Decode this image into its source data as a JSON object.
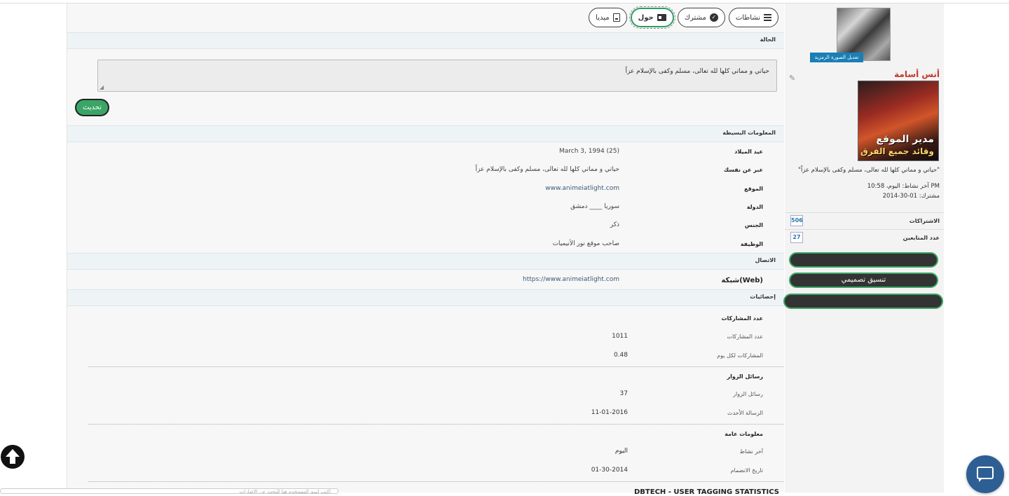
{
  "tabs": [
    {
      "label": "نشاطات",
      "icon": "list-icon"
    },
    {
      "label": "مشترك",
      "icon": "check-circle-icon"
    },
    {
      "label": "حول",
      "icon": "id-card-icon",
      "active": true
    },
    {
      "label": "ميديا",
      "icon": "media-file-icon"
    }
  ],
  "status": {
    "header": "الحالة",
    "text": "حياتي و مماتي كلها لله تعالى، مسلم وكفى بالإسلام عزاً",
    "update_label": "تحديث"
  },
  "basic": {
    "header": "المعلومات البسيطة",
    "rows": [
      {
        "label": "عيد الميلاد",
        "value": "March 3, 1994 (25)"
      },
      {
        "label": "عبر عن نفسك",
        "value": "حياتي و مماتي كلها لله تعالى، مسلم وكفى بالإسلام عزاً"
      },
      {
        "label": "الموقع",
        "value": "www.animeiatlight.com"
      },
      {
        "label": "الدولة",
        "value": "سوريا ____ دمشق"
      },
      {
        "label": "الجنس",
        "value": "ذكر"
      },
      {
        "label": "الوظيفة",
        "value": "صاحب موقع نور الأنيميات"
      }
    ]
  },
  "contact": {
    "header": "الاتصال",
    "label": "شبكة(Web)",
    "value": "https://www.animeiatlight.com"
  },
  "stats": {
    "header": "إحصائيات",
    "groups": [
      {
        "title": "عدد المشاركات",
        "rows": [
          {
            "label": "عدد المشاركات",
            "value": "1011"
          },
          {
            "label": "المشاركات لكل يوم",
            "value": "0.48"
          }
        ]
      },
      {
        "title": "رسائل الزوار",
        "rows": [
          {
            "label": "رسائل الزوار",
            "value": "37"
          },
          {
            "label": "الرسالة الأحدث",
            "value": "11-01-2016"
          }
        ]
      },
      {
        "title": "معلومات عامة",
        "rows": [
          {
            "label": "آخر نشاط",
            "value": "اليوم"
          },
          {
            "label": "تاريخ الانضمام",
            "value": "01-30-2014"
          }
        ]
      }
    ]
  },
  "bottom": {
    "title": "DBTECH - USER TAGGING STATISTICS",
    "input_text": "اكتب اسم المستخدم هنا للبحث عن الإشارات"
  },
  "sidebar": {
    "change_avatar": "تعديل الصورة الرمزية",
    "username": "أنس أسامة",
    "rank_line1": "مدير الموقع",
    "rank_line2": "وقائد جميع الفرق",
    "quote": "\"حياتي و مماتي كلها لله تعالى، مسلم وكفى بالإسلام عزاً\"",
    "last_activity": "آخر نشاط: اليوم، 10:58 PM",
    "joined": "مشترك: 01-30-2014",
    "subscriptions_label": "الاشتراكات",
    "subscriptions_count": "506",
    "followers_label": "عدد المتابعين",
    "followers_count": "27",
    "buttons": [
      "",
      "تنسيق تصميمي",
      ""
    ]
  },
  "colors": {
    "accent": "#3aa566",
    "username": "#c0392b",
    "chat": "#2d5f94",
    "link": "#3a5a78"
  }
}
